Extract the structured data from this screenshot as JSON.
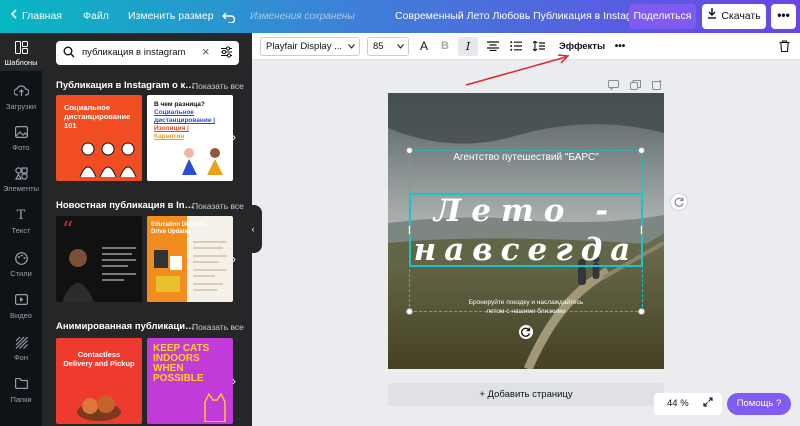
{
  "topbar": {
    "home": "Главная",
    "file": "Файл",
    "resize": "Изменить размер",
    "saved_status": "Изменения сохранены",
    "title": "Современный Лето Любовь Публикация в Instagram",
    "share": "Поделиться",
    "download": "Скачать"
  },
  "rail": [
    {
      "label": "Шаблоны",
      "icon": "templates-icon",
      "active": true
    },
    {
      "label": "Загрузки",
      "icon": "upload-icon"
    },
    {
      "label": "Фото",
      "icon": "photo-icon"
    },
    {
      "label": "Элементы",
      "icon": "elements-icon"
    },
    {
      "label": "Текст",
      "icon": "text-icon"
    },
    {
      "label": "Стили",
      "icon": "styles-icon"
    },
    {
      "label": "Видео",
      "icon": "video-icon"
    },
    {
      "label": "Фон",
      "icon": "background-icon"
    },
    {
      "label": "Папки",
      "icon": "folder-icon"
    }
  ],
  "panel": {
    "search_value": "публикация в instagram",
    "show_all": "Показать все",
    "sections": [
      {
        "title": "Публикация в Instagram о короновирусе",
        "thumbs": [
          {
            "lines": [
              "Социальное",
              "дистанцирование",
              "101"
            ],
            "bg": "#f04d23"
          },
          {
            "lines": [
              "В чем разница?",
              "Социальное",
              "дистанцирование |",
              "Изоляция |",
              "Карантин"
            ],
            "bg": "#ffffff"
          }
        ]
      },
      {
        "title": "Новостная публикация в Instagram",
        "thumbs": [
          {
            "lines": [
              "“"
            ],
            "bg": "#111111"
          },
          {
            "lines": [
              "Education Districts",
              "Drive Updates"
            ],
            "bg": "#f5f0e8"
          }
        ]
      },
      {
        "title": "Анимированная публикация в Instagram",
        "thumbs": [
          {
            "lines": [
              "Contactless",
              "Delivery and Pickup"
            ],
            "bg": "#ef3b2d"
          },
          {
            "lines": [
              "KEEP CATS",
              "INDOORS",
              "WHEN",
              "POSSIBLE"
            ],
            "bg": "#c23bd8"
          }
        ]
      }
    ]
  },
  "toolbar": {
    "font": "Playfair Display ...",
    "size": "85",
    "effects": "Эффекты"
  },
  "design": {
    "agency": "Агентство путешествий \"БАРС\"",
    "title_line1": "Лето -",
    "title_line2": "навсегда",
    "subtitle_line1": "Бронируйте поездку и наслаждайтесь",
    "subtitle_line2": "летом с нашими близкими"
  },
  "add_page": "+ Добавить страницу",
  "zoom": "44 %",
  "help": "Помощь ?",
  "colors": {
    "accent": "#7f5bf0",
    "selection": "#17c3d0",
    "annotation_arrow": "#e0262b"
  }
}
